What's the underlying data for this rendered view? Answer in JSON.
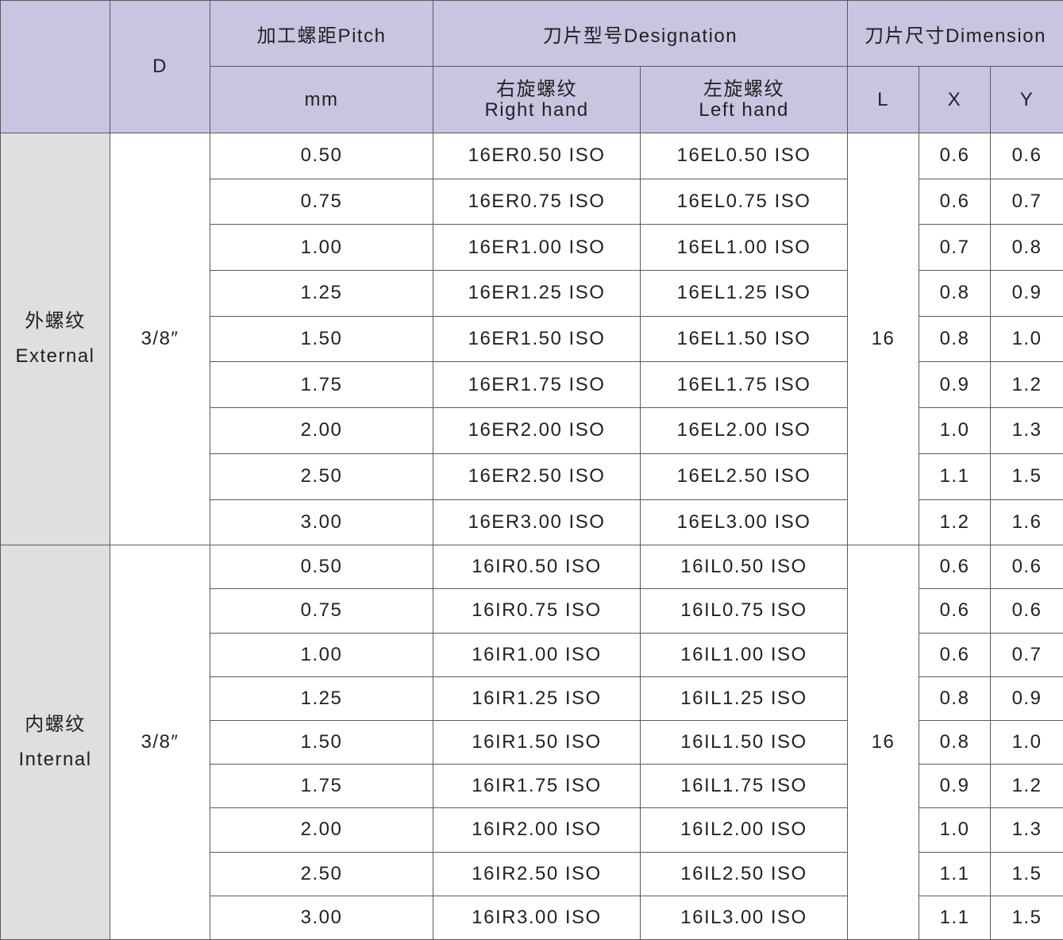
{
  "colors": {
    "header_bg": "#c9c5e0",
    "group_bg": "#dfdfdf",
    "border": "#5a5a5a",
    "text": "#231f20"
  },
  "header": {
    "d": "D",
    "pitch": "加工螺距Pitch",
    "pitch_unit": "mm",
    "designation": "刀片型号Designation",
    "right_hand_cn": "右旋螺纹",
    "right_hand_en": "Right hand",
    "left_hand_cn": "左旋螺纹",
    "left_hand_en": "Left hand",
    "dimension": "刀片尺寸Dimension",
    "l": "L",
    "x": "X",
    "y": "Y"
  },
  "groups": [
    {
      "label_cn": "外螺纹",
      "label_en": "External",
      "d": "3/8″",
      "l": "16",
      "rows": [
        {
          "pitch": "0.50",
          "right": "16ER0.50 ISO",
          "left": "16EL0.50 ISO",
          "x": "0.6",
          "y": "0.6"
        },
        {
          "pitch": "0.75",
          "right": "16ER0.75 ISO",
          "left": "16EL0.75 ISO",
          "x": "0.6",
          "y": "0.7"
        },
        {
          "pitch": "1.00",
          "right": "16ER1.00 ISO",
          "left": "16EL1.00 ISO",
          "x": "0.7",
          "y": "0.8"
        },
        {
          "pitch": "1.25",
          "right": "16ER1.25 ISO",
          "left": "16EL1.25 ISO",
          "x": "0.8",
          "y": "0.9"
        },
        {
          "pitch": "1.50",
          "right": "16ER1.50 ISO",
          "left": "16EL1.50 ISO",
          "x": "0.8",
          "y": "1.0"
        },
        {
          "pitch": "1.75",
          "right": "16ER1.75 ISO",
          "left": "16EL1.75 ISO",
          "x": "0.9",
          "y": "1.2"
        },
        {
          "pitch": "2.00",
          "right": "16ER2.00 ISO",
          "left": "16EL2.00 ISO",
          "x": "1.0",
          "y": "1.3"
        },
        {
          "pitch": "2.50",
          "right": "16ER2.50 ISO",
          "left": "16EL2.50 ISO",
          "x": "1.1",
          "y": "1.5"
        },
        {
          "pitch": "3.00",
          "right": "16ER3.00 ISO",
          "left": "16EL3.00 ISO",
          "x": "1.2",
          "y": "1.6"
        }
      ]
    },
    {
      "label_cn": "内螺纹",
      "label_en": "Internal",
      "d": "3/8″",
      "l": "16",
      "rows": [
        {
          "pitch": "0.50",
          "right": "16IR0.50 ISO",
          "left": "16IL0.50 ISO",
          "x": "0.6",
          "y": "0.6"
        },
        {
          "pitch": "0.75",
          "right": "16IR0.75 ISO",
          "left": "16IL0.75 ISO",
          "x": "0.6",
          "y": "0.6"
        },
        {
          "pitch": "1.00",
          "right": "16IR1.00 ISO",
          "left": "16IL1.00 ISO",
          "x": "0.6",
          "y": "0.7"
        },
        {
          "pitch": "1.25",
          "right": "16IR1.25 ISO",
          "left": "16IL1.25 ISO",
          "x": "0.8",
          "y": "0.9"
        },
        {
          "pitch": "1.50",
          "right": "16IR1.50 ISO",
          "left": "16IL1.50 ISO",
          "x": "0.8",
          "y": "1.0"
        },
        {
          "pitch": "1.75",
          "right": "16IR1.75 ISO",
          "left": "16IL1.75 ISO",
          "x": "0.9",
          "y": "1.2"
        },
        {
          "pitch": "2.00",
          "right": "16IR2.00 ISO",
          "left": "16IL2.00 ISO",
          "x": "1.0",
          "y": "1.3"
        },
        {
          "pitch": "2.50",
          "right": "16IR2.50 ISO",
          "left": "16IL2.50 ISO",
          "x": "1.1",
          "y": "1.5"
        },
        {
          "pitch": "3.00",
          "right": "16IR3.00 ISO",
          "left": "16IL3.00 ISO",
          "x": "1.1",
          "y": "1.5"
        }
      ]
    }
  ]
}
